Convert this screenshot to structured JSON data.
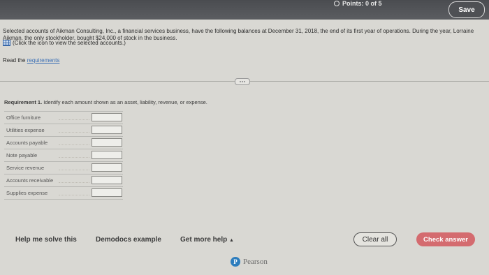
{
  "header": {
    "points_label": "Points: 0 of 5",
    "save_label": "Save"
  },
  "problem": {
    "intro": "Selected accounts of Aikman Consulting, Inc., a financial services business, have the following balances at December 31, 2018, the end of its first year of operations. During the year, Lorraine Aikman, the only stockholder, bought $24,000 of stock in the business.",
    "note": "(Click the icon to view the selected accounts.)",
    "read_prefix": "Read the",
    "requirements_link": "requirements"
  },
  "requirement": {
    "label": "Requirement 1.",
    "text": "Identify each amount shown as an asset, liability, revenue, or expense.",
    "items": [
      {
        "name": "Office furniture",
        "value": ""
      },
      {
        "name": "Utilities expense",
        "value": ""
      },
      {
        "name": "Accounts payable",
        "value": ""
      },
      {
        "name": "Note payable",
        "value": ""
      },
      {
        "name": "Service revenue",
        "value": ""
      },
      {
        "name": "Accounts receivable",
        "value": ""
      },
      {
        "name": "Supplies expense",
        "value": ""
      }
    ]
  },
  "footer": {
    "help_label": "Help me solve this",
    "demodocs_label": "Demodocs example",
    "more_help_label": "Get more help",
    "clear_label": "Clear all",
    "check_label": "Check answer",
    "brand": "Pearson"
  },
  "colors": {
    "check_answer_bg": "#d46b6f",
    "link": "#3a6fb5"
  }
}
